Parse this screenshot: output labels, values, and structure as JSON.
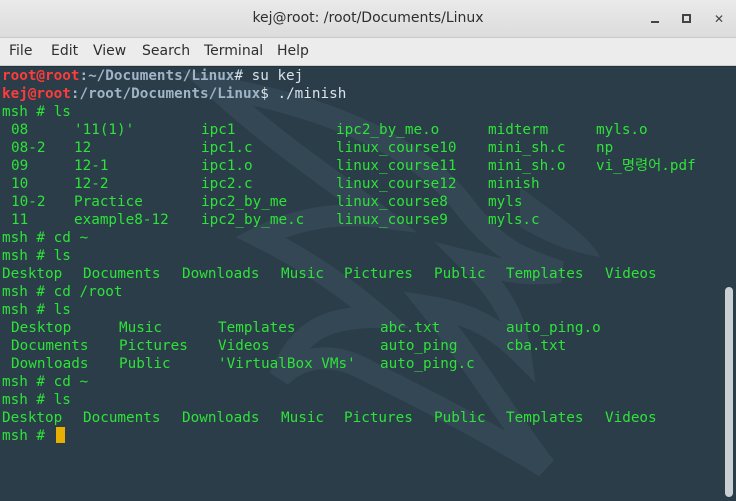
{
  "window": {
    "title": "kej@root: /root/Documents/Linux"
  },
  "menubar": [
    "File",
    "Edit",
    "View",
    "Search",
    "Terminal",
    "Help"
  ],
  "terminal": {
    "line1": {
      "user": "root@root",
      "path": ":~/Documents/Linux",
      "cmd": "# su kej"
    },
    "line2": {
      "user": "kej@root",
      "path": ":/root/Documents/Linux",
      "cmd": "$ ./minish"
    },
    "prompt": "msh # ",
    "ls1_cmd": "ls",
    "ls1_rows": [
      [
        "08",
        "'11(1)'",
        "ipc1",
        "ipc2_by_me.o",
        "midterm",
        "myls.o"
      ],
      [
        "08-2",
        "12",
        "ipc1.c",
        "linux_course10",
        "mini_sh.c",
        "np"
      ],
      [
        "09",
        "12-1",
        "ipc1.o",
        "linux_course11",
        "mini_sh.o",
        "vi_명령어.pdf"
      ],
      [
        "10",
        "12-2",
        "ipc2.c",
        "linux_course12",
        "minish",
        ""
      ],
      [
        "10-2",
        "Practice",
        "ipc2_by_me",
        "linux_course8",
        "myls",
        ""
      ],
      [
        "11",
        "example8-12",
        "ipc2_by_me.c",
        "linux_course9",
        "myls.c",
        ""
      ]
    ],
    "cd_home": "cd ~",
    "ls2_cmd": "ls",
    "home_listing": [
      "Desktop",
      "Documents",
      "Downloads",
      "Music",
      "Pictures",
      "Public",
      "Templates",
      "Videos"
    ],
    "cd_root": "cd /root",
    "ls3_cmd": "ls",
    "root_rows": [
      [
        "Desktop",
        "Music",
        "Templates",
        "abc.txt",
        "auto_ping.o"
      ],
      [
        "Documents",
        "Pictures",
        "Videos",
        "auto_ping",
        "cba.txt"
      ],
      [
        "Downloads",
        "Public",
        "'VirtualBox VMs'",
        "auto_ping.c",
        ""
      ]
    ],
    "cd_home2": "cd ~",
    "ls4_cmd": "ls",
    "home_listing2": [
      "Desktop",
      "Documents",
      "Downloads",
      "Music",
      "Pictures",
      "Public",
      "Templates",
      "Videos"
    ]
  },
  "colors": {
    "background": "#2a3d48",
    "text": "#2fe23a",
    "user": "#ff3b3b",
    "path": "#9fb4c6",
    "cursor": "#e7b000"
  },
  "icons": {
    "minimize": "minimize-icon",
    "maximize": "maximize-icon",
    "close": "close-icon"
  }
}
